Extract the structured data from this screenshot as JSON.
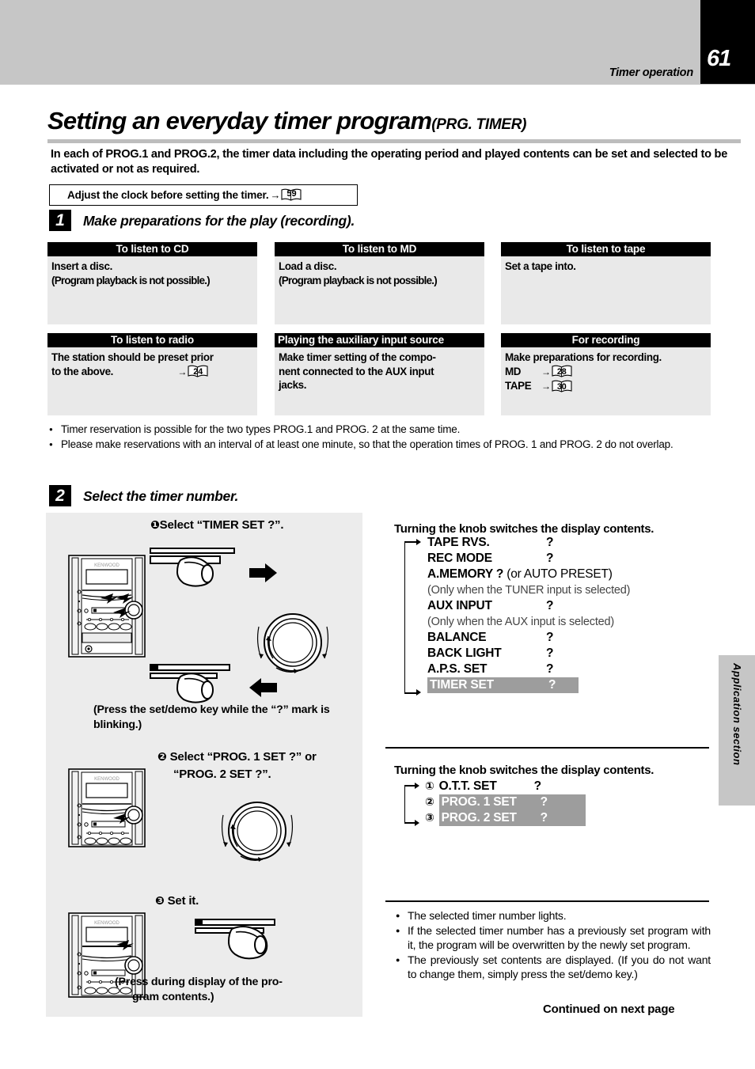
{
  "header": {
    "page_number": "61",
    "section_name": "Timer operation",
    "side_tab": "Application section"
  },
  "title": {
    "main": "Setting an everyday timer program",
    "sub": "(PRG. TIMER)"
  },
  "intro": "In each of PROG.1 and PROG.2, the timer data including the operating period and played contents can be set and selected to be activated or not as required.",
  "clock_note": {
    "text": "Adjust the clock before setting the timer.",
    "arrow": "→",
    "page_ref": "59"
  },
  "step1": {
    "number": "1",
    "title": "Make preparations for the play (recording)."
  },
  "mode_boxes": [
    {
      "header": "To listen to CD",
      "header_align": "center",
      "lines": [
        "Insert a disc.",
        "(Program playback is not possible.)"
      ]
    },
    {
      "header": "To listen to MD",
      "header_align": "center",
      "lines": [
        "Load a disc.",
        "(Program playback is not possible.)"
      ]
    },
    {
      "header": "To listen to tape",
      "header_align": "center",
      "lines": [
        "Set a tape into."
      ]
    },
    {
      "header": "To listen to radio",
      "header_align": "center",
      "lines": [
        "The station should be preset prior",
        "to the above."
      ],
      "ref": "24"
    },
    {
      "header": "Playing the auxiliary input source",
      "header_align": "left",
      "lines": [
        "Make timer setting of the compo-",
        "nent connected to the AUX input",
        "jacks."
      ]
    },
    {
      "header": "For recording",
      "header_align": "center",
      "lines": [
        "Make preparations for recording."
      ],
      "refs": [
        {
          "label": "MD",
          "page": "28"
        },
        {
          "label": "TAPE",
          "page": "30"
        }
      ]
    }
  ],
  "bullets": [
    "Timer reservation is possible for the two types PROG.1 and PROG. 2 at the same time.",
    "Please make reservations with an interval of at least one minute, so that the operation times of PROG. 1 and PROG. 2 do not overlap."
  ],
  "step2": {
    "number": "2",
    "title": "Select the timer number.",
    "sub1": {
      "marker": "❶",
      "label": "Select “TIMER SET ?”.",
      "note": "(Press the set/demo key while the “?” mark is blinking.)"
    },
    "sub2": {
      "marker": "❷",
      "label_line1": "Select “PROG. 1 SET ?” or",
      "label_line2": "“PROG. 2 SET ?”."
    },
    "sub3": {
      "marker": "❸",
      "label": "Set it.",
      "note": "(Press during display of the pro-gram contents.)",
      "note_line1": "(Press during display of the pro-",
      "note_line2": "gram contents.)"
    }
  },
  "display_list_1": {
    "title": "Turning the knob switches the display contents.",
    "rows": [
      {
        "name": "TAPE RVS.",
        "mark": "?",
        "highlight": false
      },
      {
        "name": "REC MODE",
        "mark": "?",
        "highlight": false
      },
      {
        "name": "A.MEMORY  ?",
        "mark": "(or AUTO PRESET)",
        "highlight": false,
        "inline": true
      },
      {
        "condition": "(Only when the TUNER input is selected)"
      },
      {
        "name": "AUX INPUT",
        "mark": "?",
        "highlight": false
      },
      {
        "condition": "(Only when the AUX input is selected)"
      },
      {
        "name": "BALANCE",
        "mark": "?",
        "highlight": false
      },
      {
        "name": "BACK LIGHT",
        "mark": "?",
        "highlight": false
      },
      {
        "name": "A.P.S. SET",
        "mark": "?",
        "highlight": false
      },
      {
        "name": "TIMER SET",
        "mark": "?",
        "highlight": true
      }
    ]
  },
  "display_list_2": {
    "title": "Turning the knob switches the display contents.",
    "rows": [
      {
        "num": "①",
        "name": "O.T.T.  SET",
        "mark": "?",
        "highlight": false
      },
      {
        "num": "②",
        "name": "PROG. 1  SET",
        "mark": "?",
        "highlight": true
      },
      {
        "num": "③",
        "name": "PROG. 2  SET",
        "mark": "?",
        "highlight": true
      }
    ]
  },
  "notes": [
    "The selected timer number lights.",
    "If the selected timer number has a previously set program with it, the program will be overwritten by the newly set program.",
    "The previously set contents are displayed. (If you do not want to change them, simply press the set/demo key.)"
  ],
  "continued": "Continued on next page"
}
